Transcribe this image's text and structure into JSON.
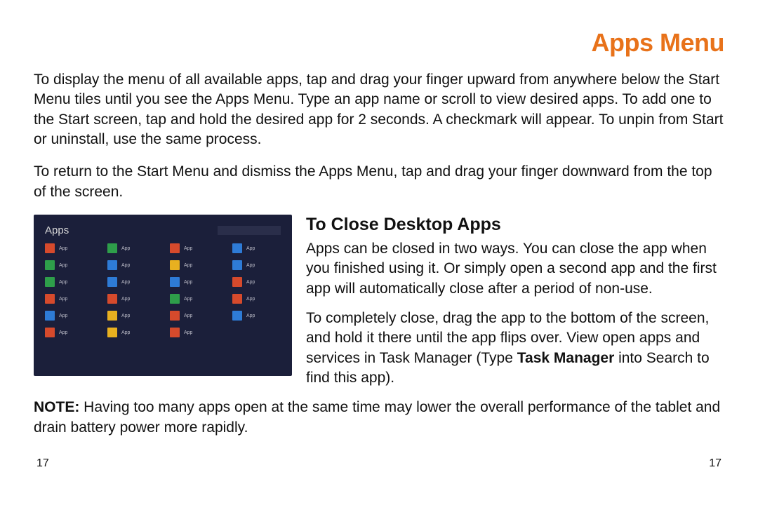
{
  "title": "Apps Menu",
  "para1": "To display the menu of all available apps, tap and drag your finger upward from anywhere below the Start Menu tiles until you see the Apps Menu. Type an app name or scroll to view desired apps. To add one to the Start screen, tap and hold the desired app for 2 seconds. A checkmark will appear. To unpin from Start or uninstall, use the same process.",
  "para2": "To return to the Start Menu and dismiss the Apps Menu, tap and drag your finger downward from the top of the screen.",
  "subtitle": "To Close Desktop Apps",
  "close_p1": "Apps can be closed in two ways. You can close the app when you finished using it. Or simply open a second app and the first app will automatically close after a period of non-use.",
  "close_p2a": "To completely close, drag the app to the bottom of the screen, and hold it there until the app flips over. View open apps and services in Task Manager (Type ",
  "close_p2_bold": "Task Manager",
  "close_p2b": " into Search to find this app).",
  "note_label": "NOTE:",
  "note_text": " Having too many apps open at the same time may lower the overall performance of the tablet and drain battery power more rapidly.",
  "page_left": "17",
  "page_right": "17",
  "shot": {
    "title": "Apps",
    "apps": [
      [
        {
          "c": "#d64a2c",
          "t": "App"
        },
        {
          "c": "#2e9e4a",
          "t": "App"
        },
        {
          "c": "#2e9e4a",
          "t": "App"
        },
        {
          "c": "#d64a2c",
          "t": "App"
        },
        {
          "c": "#2e7bd6",
          "t": "App"
        },
        {
          "c": "#d64a2c",
          "t": "App"
        }
      ],
      [
        {
          "c": "#2e9e4a",
          "t": "App"
        },
        {
          "c": "#2e7bd6",
          "t": "App"
        },
        {
          "c": "#2e7bd6",
          "t": "App"
        },
        {
          "c": "#d64a2c",
          "t": "App"
        },
        {
          "c": "#e8b020",
          "t": "App"
        },
        {
          "c": "#e8b020",
          "t": "App"
        }
      ],
      [
        {
          "c": "#d64a2c",
          "t": "App"
        },
        {
          "c": "#e8b020",
          "t": "App"
        },
        {
          "c": "#2e7bd6",
          "t": "App"
        },
        {
          "c": "#2e9e4a",
          "t": "App"
        },
        {
          "c": "#d64a2c",
          "t": "App"
        },
        {
          "c": "#d64a2c",
          "t": "App"
        }
      ],
      [
        {
          "c": "#2e7bd6",
          "t": "App"
        },
        {
          "c": "#2e7bd6",
          "t": "App"
        },
        {
          "c": "#d64a2c",
          "t": "App"
        },
        {
          "c": "#d64a2c",
          "t": "App"
        },
        {
          "c": "#2e7bd6",
          "t": "App"
        }
      ]
    ]
  }
}
